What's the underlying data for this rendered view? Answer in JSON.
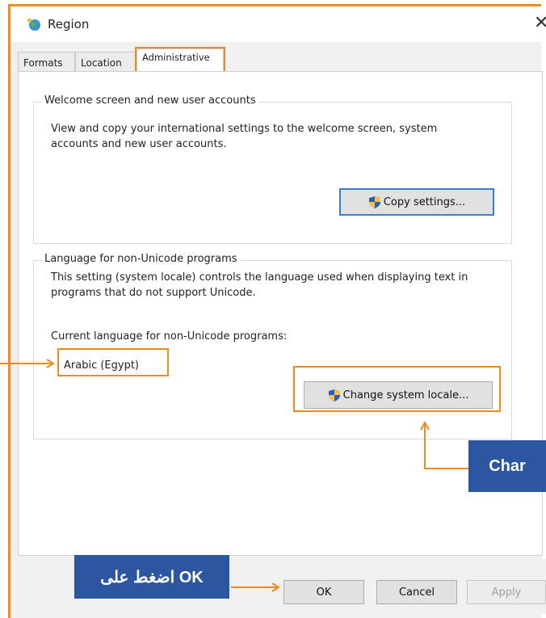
{
  "window": {
    "title": "Region",
    "close_glyph": "✕"
  },
  "tabs": [
    {
      "label": "Formats"
    },
    {
      "label": "Location"
    },
    {
      "label": "Administrative"
    }
  ],
  "welcome_group": {
    "legend": "Welcome screen and new user accounts",
    "description": "View and copy your international settings to the welcome screen, system accounts and new user accounts.",
    "copy_button": "Copy settings..."
  },
  "nonunicode_group": {
    "legend": "Language for non-Unicode programs",
    "description": "This setting (system locale) controls the language used when displaying text in programs that do not support Unicode.",
    "current_label": "Current language for non-Unicode programs:",
    "current_value": "Arabic (Egypt)",
    "change_button": "Change system locale..."
  },
  "footer": {
    "ok": "OK",
    "cancel": "Cancel",
    "apply": "Apply"
  },
  "annotations": {
    "change_label": "Char",
    "ok_label": "اضغط على OK",
    "accent_color": "#ed8b1f",
    "label_color": "#2c56a0"
  },
  "icons": [
    "region-globe-icon",
    "close-icon",
    "shield-icon"
  ]
}
